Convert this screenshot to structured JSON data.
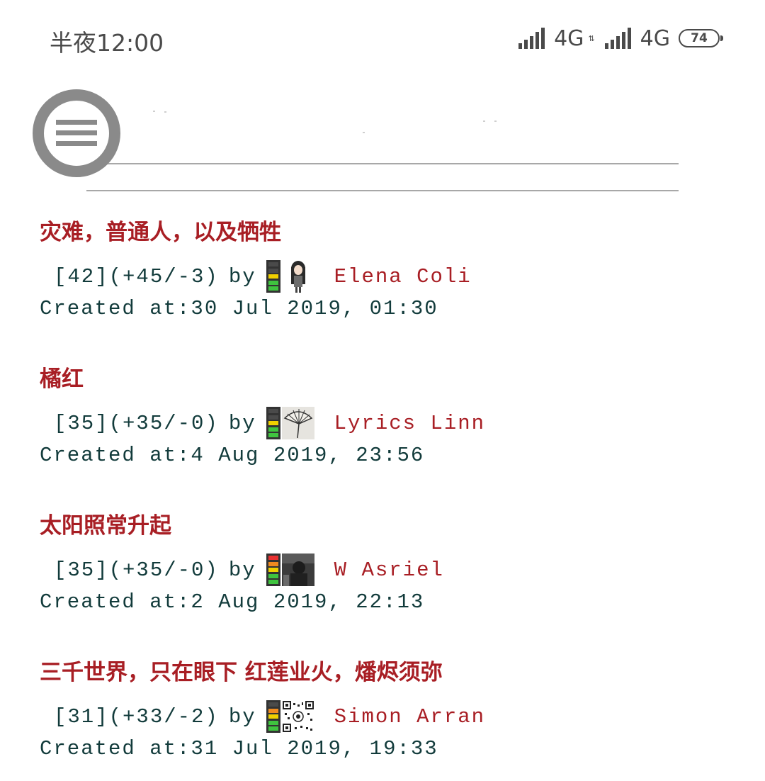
{
  "status_bar": {
    "time": "半夜12:00",
    "network_1": "4G",
    "network_2": "4G",
    "battery_level": "74"
  },
  "colors": {
    "title": "#a81e24",
    "meta": "#123b3b",
    "menu_gray": "#8a8a8a"
  },
  "posts": [
    {
      "title": "灾难，普通人，以及牺牲",
      "rating": "[42](+45/-3)",
      "by": "by",
      "author": "Elena Coli",
      "created": "Created at:30 Jul 2019, 01:30",
      "meter_lit": "green-yellow",
      "avatar_icon": "anime-girl-avatar-icon"
    },
    {
      "title": "橘红",
      "rating": "[35](+35/-0)",
      "by": "by",
      "author": "Lyrics Linn",
      "created": "Created at:4 Aug 2019, 23:56",
      "meter_lit": "green-yellow",
      "avatar_icon": "fan-sketch-avatar-icon"
    },
    {
      "title": "太阳照常升起",
      "rating": "[35](+35/-0)",
      "by": "by",
      "author": "W Asriel",
      "created": "Created at:2 Aug 2019, 22:13",
      "meter_lit": "full",
      "avatar_icon": "dark-photo-avatar-icon"
    },
    {
      "title": "三千世界，只在眼下 红莲业火，燔烬须弥",
      "rating": "[31](+33/-2)",
      "by": "by",
      "author": "Simon Arran",
      "created": "Created at:31 Jul 2019, 19:33",
      "meter_lit": "green-yellow",
      "avatar_icon": "qr-code-avatar-icon"
    }
  ]
}
